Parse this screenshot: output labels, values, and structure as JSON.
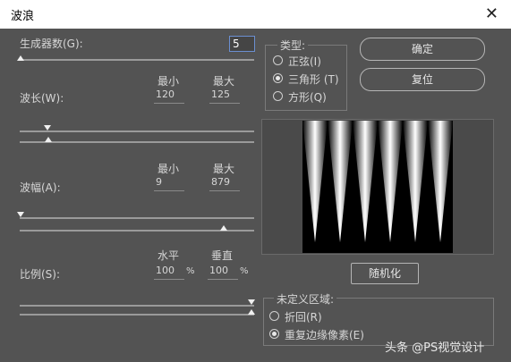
{
  "dialog": {
    "title": "波浪",
    "close_glyph": "✕"
  },
  "generators": {
    "label": "生成器数(G):",
    "value": "5"
  },
  "wavelength": {
    "label": "波长(W):",
    "min_header": "最小",
    "max_header": "最大",
    "min": "120",
    "max": "125",
    "min_level": 0.1,
    "max_level": 0.11
  },
  "amplitude": {
    "label": "波幅(A):",
    "min_header": "最小",
    "max_header": "最大",
    "min": "9",
    "max": "879",
    "min_level": 0.0,
    "max_level": 0.88
  },
  "scale": {
    "label": "比例(S):",
    "h_header": "水平",
    "v_header": "垂直",
    "h": "100",
    "v": "100",
    "unit": "%",
    "h_level": 1.0,
    "v_level": 1.0
  },
  "type_group": {
    "title": "类型:",
    "options": [
      {
        "label": "正弦(I)",
        "selected": false
      },
      {
        "label": "三角形 (T)",
        "selected": true
      },
      {
        "label": "方形(Q)",
        "selected": false
      }
    ]
  },
  "buttons": {
    "ok": "确定",
    "reset": "复位",
    "randomize": "随机化"
  },
  "undefined_area": {
    "title": "未定义区域:",
    "options": [
      {
        "label": "折回(R)",
        "selected": false
      },
      {
        "label": "重复边缘像素(E)",
        "selected": true
      }
    ]
  },
  "watermark": "头条 @PS视觉设计"
}
